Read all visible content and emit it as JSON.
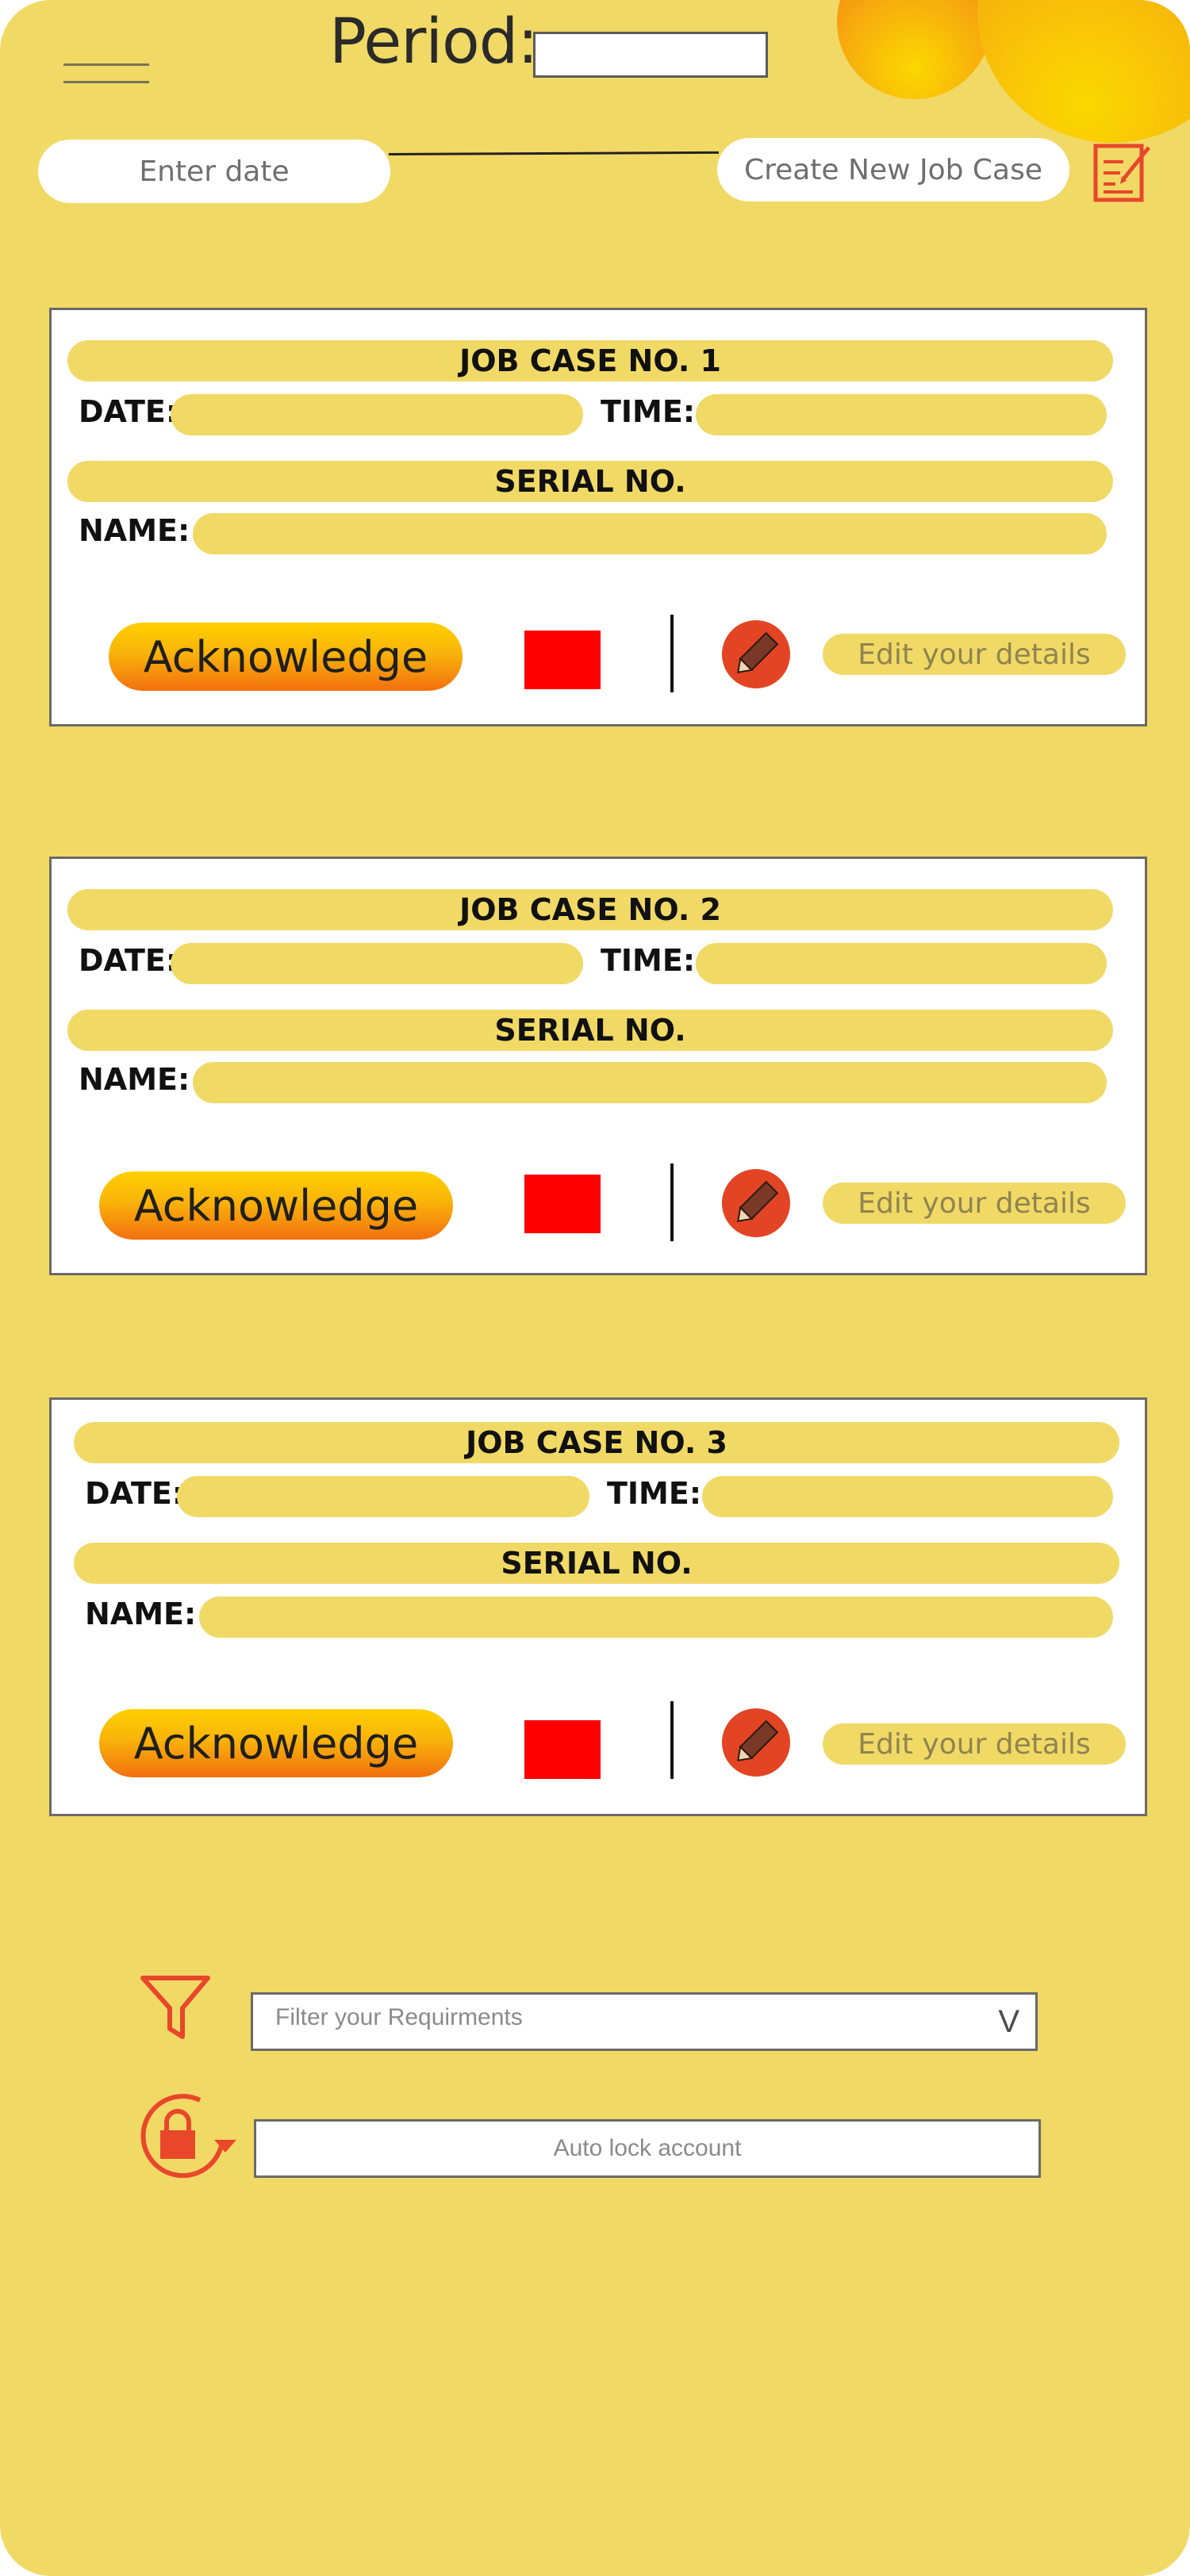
{
  "header": {
    "period_label": "Period:",
    "period_value": "",
    "date_placeholder": "Enter date",
    "create_button": "Create New Job Case"
  },
  "icons": {
    "menu": "hamburger-menu-icon",
    "new_case": "edit-document-icon",
    "edit": "pencil-icon",
    "filter": "filter-funnel-icon",
    "auto_lock": "lock-rotate-icon"
  },
  "colors": {
    "background": "#f1d966",
    "accent": "#e8472a",
    "status_red": "#ff0000",
    "button_gradient_top": "#ffd000",
    "button_gradient_bottom": "#f2700f"
  },
  "job_cases": [
    {
      "title": "JOB CASE NO. 1",
      "date_label": "DATE:",
      "time_label": "TIME:",
      "serial_label": "SERIAL NO.",
      "name_label": "NAME:",
      "ack_label": "Acknowledge",
      "edit_label": "Edit your details"
    },
    {
      "title": "JOB CASE NO. 2",
      "date_label": "DATE:",
      "time_label": "TIME:",
      "serial_label": "SERIAL NO.",
      "name_label": "NAME:",
      "ack_label": "Acknowledge",
      "edit_label": "Edit your details"
    },
    {
      "title": "JOB CASE NO. 3",
      "date_label": "DATE:",
      "time_label": "TIME:",
      "serial_label": "SERIAL NO.",
      "name_label": "NAME:",
      "ack_label": "Acknowledge",
      "edit_label": "Edit your details"
    }
  ],
  "filter": {
    "placeholder": "Filter your Requirments",
    "chevron": "V"
  },
  "auto_lock": {
    "label": "Auto lock account"
  }
}
